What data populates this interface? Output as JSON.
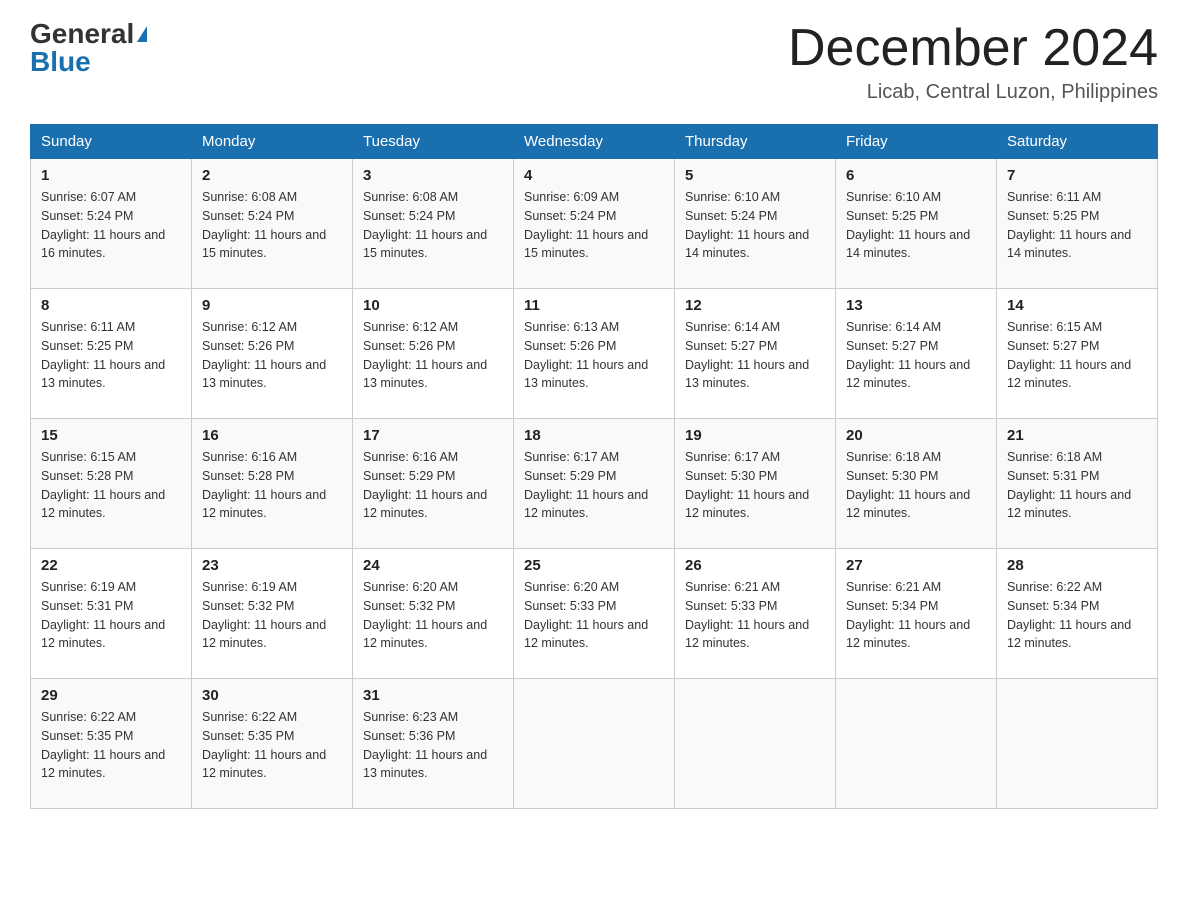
{
  "header": {
    "logo_general": "General",
    "logo_blue": "Blue",
    "title": "December 2024",
    "subtitle": "Licab, Central Luzon, Philippines"
  },
  "days_of_week": [
    "Sunday",
    "Monday",
    "Tuesday",
    "Wednesday",
    "Thursday",
    "Friday",
    "Saturday"
  ],
  "weeks": [
    [
      {
        "day": "1",
        "sunrise": "6:07 AM",
        "sunset": "5:24 PM",
        "daylight": "11 hours and 16 minutes."
      },
      {
        "day": "2",
        "sunrise": "6:08 AM",
        "sunset": "5:24 PM",
        "daylight": "11 hours and 15 minutes."
      },
      {
        "day": "3",
        "sunrise": "6:08 AM",
        "sunset": "5:24 PM",
        "daylight": "11 hours and 15 minutes."
      },
      {
        "day": "4",
        "sunrise": "6:09 AM",
        "sunset": "5:24 PM",
        "daylight": "11 hours and 15 minutes."
      },
      {
        "day": "5",
        "sunrise": "6:10 AM",
        "sunset": "5:24 PM",
        "daylight": "11 hours and 14 minutes."
      },
      {
        "day": "6",
        "sunrise": "6:10 AM",
        "sunset": "5:25 PM",
        "daylight": "11 hours and 14 minutes."
      },
      {
        "day": "7",
        "sunrise": "6:11 AM",
        "sunset": "5:25 PM",
        "daylight": "11 hours and 14 minutes."
      }
    ],
    [
      {
        "day": "8",
        "sunrise": "6:11 AM",
        "sunset": "5:25 PM",
        "daylight": "11 hours and 13 minutes."
      },
      {
        "day": "9",
        "sunrise": "6:12 AM",
        "sunset": "5:26 PM",
        "daylight": "11 hours and 13 minutes."
      },
      {
        "day": "10",
        "sunrise": "6:12 AM",
        "sunset": "5:26 PM",
        "daylight": "11 hours and 13 minutes."
      },
      {
        "day": "11",
        "sunrise": "6:13 AM",
        "sunset": "5:26 PM",
        "daylight": "11 hours and 13 minutes."
      },
      {
        "day": "12",
        "sunrise": "6:14 AM",
        "sunset": "5:27 PM",
        "daylight": "11 hours and 13 minutes."
      },
      {
        "day": "13",
        "sunrise": "6:14 AM",
        "sunset": "5:27 PM",
        "daylight": "11 hours and 12 minutes."
      },
      {
        "day": "14",
        "sunrise": "6:15 AM",
        "sunset": "5:27 PM",
        "daylight": "11 hours and 12 minutes."
      }
    ],
    [
      {
        "day": "15",
        "sunrise": "6:15 AM",
        "sunset": "5:28 PM",
        "daylight": "11 hours and 12 minutes."
      },
      {
        "day": "16",
        "sunrise": "6:16 AM",
        "sunset": "5:28 PM",
        "daylight": "11 hours and 12 minutes."
      },
      {
        "day": "17",
        "sunrise": "6:16 AM",
        "sunset": "5:29 PM",
        "daylight": "11 hours and 12 minutes."
      },
      {
        "day": "18",
        "sunrise": "6:17 AM",
        "sunset": "5:29 PM",
        "daylight": "11 hours and 12 minutes."
      },
      {
        "day": "19",
        "sunrise": "6:17 AM",
        "sunset": "5:30 PM",
        "daylight": "11 hours and 12 minutes."
      },
      {
        "day": "20",
        "sunrise": "6:18 AM",
        "sunset": "5:30 PM",
        "daylight": "11 hours and 12 minutes."
      },
      {
        "day": "21",
        "sunrise": "6:18 AM",
        "sunset": "5:31 PM",
        "daylight": "11 hours and 12 minutes."
      }
    ],
    [
      {
        "day": "22",
        "sunrise": "6:19 AM",
        "sunset": "5:31 PM",
        "daylight": "11 hours and 12 minutes."
      },
      {
        "day": "23",
        "sunrise": "6:19 AM",
        "sunset": "5:32 PM",
        "daylight": "11 hours and 12 minutes."
      },
      {
        "day": "24",
        "sunrise": "6:20 AM",
        "sunset": "5:32 PM",
        "daylight": "11 hours and 12 minutes."
      },
      {
        "day": "25",
        "sunrise": "6:20 AM",
        "sunset": "5:33 PM",
        "daylight": "11 hours and 12 minutes."
      },
      {
        "day": "26",
        "sunrise": "6:21 AM",
        "sunset": "5:33 PM",
        "daylight": "11 hours and 12 minutes."
      },
      {
        "day": "27",
        "sunrise": "6:21 AM",
        "sunset": "5:34 PM",
        "daylight": "11 hours and 12 minutes."
      },
      {
        "day": "28",
        "sunrise": "6:22 AM",
        "sunset": "5:34 PM",
        "daylight": "11 hours and 12 minutes."
      }
    ],
    [
      {
        "day": "29",
        "sunrise": "6:22 AM",
        "sunset": "5:35 PM",
        "daylight": "11 hours and 12 minutes."
      },
      {
        "day": "30",
        "sunrise": "6:22 AM",
        "sunset": "5:35 PM",
        "daylight": "11 hours and 12 minutes."
      },
      {
        "day": "31",
        "sunrise": "6:23 AM",
        "sunset": "5:36 PM",
        "daylight": "11 hours and 13 minutes."
      },
      null,
      null,
      null,
      null
    ]
  ]
}
